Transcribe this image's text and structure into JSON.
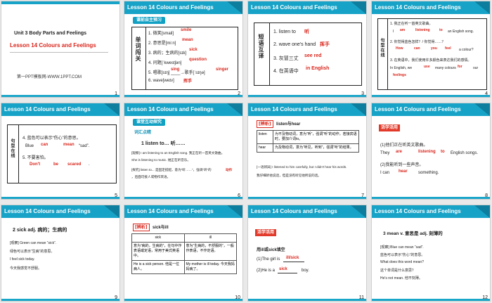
{
  "lesson_header": "Lesson 14   Colours and Feelings",
  "slides": {
    "s1": {
      "num": "1",
      "unit": "Unit 3  Body Parts and Feelings",
      "lesson": "Lesson 14  Colours and Feelings",
      "footer": "第一PPT模板网-WWW.1PPT.COM"
    },
    "s2": {
      "num": "2",
      "banner": "课前自主预习",
      "side": "单词闯关",
      "rows": [
        {
          "q": "1. 微笑[smail]",
          "a": "smile"
        },
        {
          "q": "2. 意思是[miːn]",
          "a": "mean"
        },
        {
          "q": "3. 病的；生病的[sɪk]",
          "a": "sick"
        },
        {
          "q": "4. 问题[ˈkwestʃən]",
          "a": "question"
        },
        {
          "q": "5. 唱歌[sɪŋ] ____→歌手[ˈsɪŋə]",
          "a": "sing",
          "a2": "singer"
        },
        {
          "q": "6. wave[weɪv]",
          "a": "挥手"
        }
      ]
    },
    "s3": {
      "num": "3",
      "side": "短语互译",
      "rows": [
        {
          "q": "1. listen to",
          "a": "听"
        },
        {
          "q": "2. wave one's hand",
          "a": "挥手"
        },
        {
          "q": "3. 灰冒三丈",
          "a": "see red"
        },
        {
          "q": "4. 在英语中",
          "a": "in English"
        }
      ]
    },
    "s4": {
      "num": "4",
      "side": "句型在线",
      "l1": "1. 我正在听一首英文歌曲。",
      "l2a": "I",
      "l2b": "am",
      "l2c": "listening",
      "l2d": "to",
      "l2e": "an English song.",
      "l3": "2. 你觉得蓝色怎样？/ 你觉得……？",
      "l4a": "How",
      "l4b": "can",
      "l4c": "you",
      "l4d": "feel",
      "l4e": "a colour?",
      "l5": "3. 在英语中，我们使用许多颜色来表达我们的感情。",
      "l6a": "In English, we",
      "l6b": "use",
      "l6c": "many colours",
      "l6d": "for",
      "l6e": "our",
      "l6f": "feelings"
    },
    "s5": {
      "num": "5",
      "side": "句型在线",
      "l1": "4. 蓝色可以表示“伤心”的意思。",
      "l2a": "Blue",
      "l2b": "can",
      "l2c": "mean",
      "l2d": "“sad”.",
      "l3": "5. 不要害怕。",
      "l4a": "Don't",
      "l4b": "be",
      "l4c": "scared",
      "l4d": "."
    },
    "s6": {
      "num": "6",
      "banner": "课堂互动探究",
      "sub": "词汇点睛",
      "head": "1   listen to… 听……",
      "p1": "[观察] I am listening to an English song. 我正在听一首英文歌曲。",
      "p2": "She is listening to music. 她正在听音乐。",
      "p3": "[探究] listen to... 是固定搭配，意为“听……”，强调“听”的",
      "p3r": "动作",
      "p4": "，后面可接人或物作宾语。"
    },
    "s7": {
      "num": "7",
      "tag": "[辨析]",
      "title": "listen与hear",
      "c1h": "listen",
      "c1": "为不及物动词，意为“听”，强调“听”的动作，若接宾语时，要加介词to。",
      "c2h": "hear",
      "c2": "为及物动词，意为“听见，听到”，强调“听”的结果。",
      "ex": "[一语辨异] I listened to him carefully, but I didn't hear his words.",
      "ex2": "我仔细听他说话，但是没有听见他所说的话。"
    },
    "s8": {
      "num": "8",
      "sub": "活学活用",
      "l1": "(1)他们正在听英文歌曲。",
      "l2a": "They",
      "l2b": "are",
      "l2c": "listening",
      "l2d": "to",
      "l2e": "English songs.",
      "l3": "(2)我能听到一些声音。",
      "l4a": "I can",
      "l4b": "hear",
      "l4c": "something."
    },
    "s9": {
      "num": "9",
      "head": "2   sick adj. 病的；生病的",
      "p1": "[观察] Green can mean “sick”.",
      "p2": "绿色可以表示“生病”的意思。",
      "p3": "I feel sick today.",
      "p4": "今天我感觉不舒服。"
    },
    "s10": {
      "num": "10",
      "tag": "[辨析]",
      "title": "sick与ill",
      "c1h": "sick",
      "c2h": "ill",
      "c1": "意为“病的，生病的”，在句中作表语或定语，常用于美式英语中。",
      "c2": "意为“生病的，不舒服的”，一般作表语，不作定语。",
      "e1": "He is a sick person. 他是一位病人。",
      "e2": "My mother is ill today. 今天我妈妈病了。"
    },
    "s11": {
      "num": "11",
      "sub": "活学活用",
      "l1": "用ill或sick填空",
      "l2a": "(1)The girl is",
      "l2b": "ill/sick",
      "l3a": "(2)He is a",
      "l3b": "sick",
      "l3c": "boy."
    },
    "s12": {
      "num": "12",
      "head": "3   mean v. 意思是    adj. 刻薄的",
      "p1": "[观察] Blue can mean “sad”.",
      "p2": "蓝色可以表示“伤心”的意思。",
      "p3": "What does this word mean?",
      "p4": "这个单词是什么意思？",
      "p5": "He's not mean. 他不刻薄。"
    }
  }
}
